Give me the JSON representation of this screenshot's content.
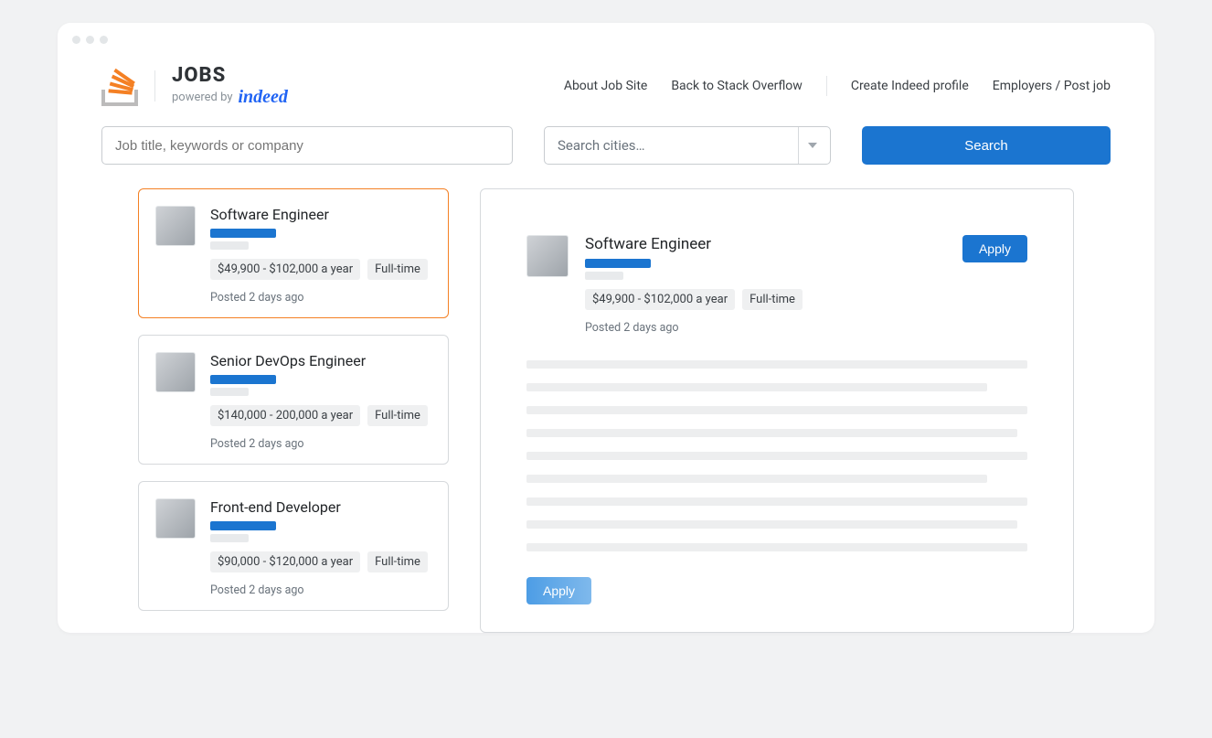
{
  "brand": {
    "jobs": "JOBS",
    "powered_by": "powered by",
    "indeed": "indeed"
  },
  "nav": {
    "about": "About Job Site",
    "back": "Back to Stack Overflow",
    "create_profile": "Create Indeed profile",
    "employers": "Employers / Post job"
  },
  "search": {
    "keywords_placeholder": "Job title, keywords or company",
    "city_placeholder": "Search cities…",
    "button": "Search"
  },
  "apply_label": "Apply",
  "jobs": [
    {
      "title": "Software Engineer",
      "salary": "$49,900 - $102,000 a year",
      "type": "Full-time",
      "posted": "Posted 2 days ago",
      "selected": true
    },
    {
      "title": "Senior DevOps Engineer",
      "salary": "$140,000 - 200,000 a year",
      "type": "Full-time",
      "posted": "Posted 2 days ago",
      "selected": false
    },
    {
      "title": "Front-end Developer",
      "salary": "$90,000 - $120,000 a year",
      "type": "Full-time",
      "posted": "Posted 2 days ago",
      "selected": false
    }
  ],
  "detail": {
    "title": "Software Engineer",
    "salary": "$49,900 - $102,000 a year",
    "type": "Full-time",
    "posted": "Posted 2 days ago"
  }
}
